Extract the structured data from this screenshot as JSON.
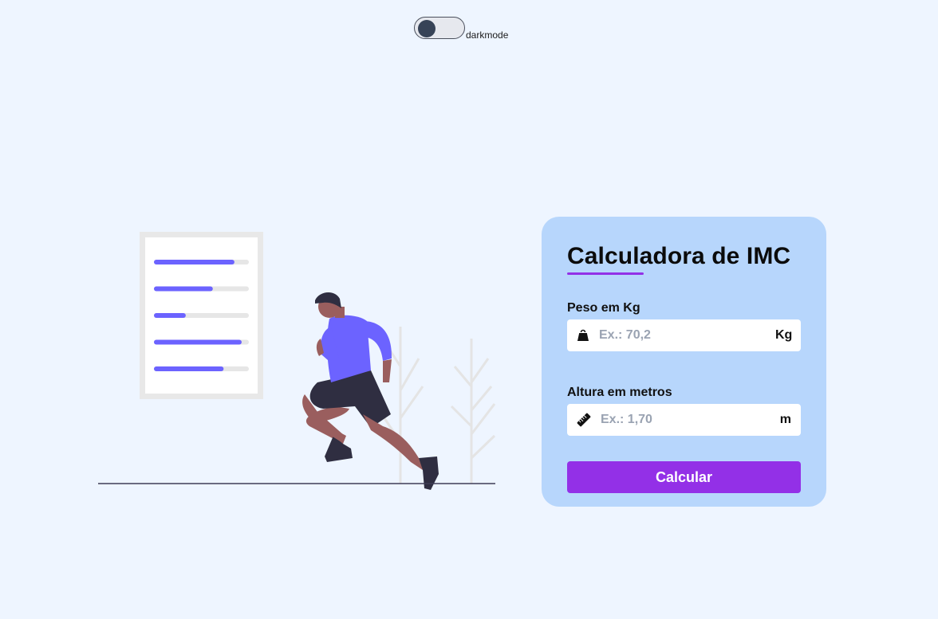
{
  "toggle": {
    "label": "darkmode"
  },
  "calculator": {
    "title": "Calculadora de IMC",
    "weight": {
      "label": "Peso em Kg",
      "placeholder": "Ex.: 70,2",
      "unit": "Kg",
      "icon": "weight-icon"
    },
    "height": {
      "label": "Altura em metros",
      "placeholder": "Ex.: 1,70",
      "unit": "m",
      "icon": "ruler-icon"
    },
    "button_label": "Calcular"
  },
  "colors": {
    "background": "#eef5ff",
    "card": "#b7d6fc",
    "accent": "#9330e7",
    "illustration_primary": "#6c63ff"
  },
  "illustration": {
    "subject": "person-running",
    "checklist_progress": [
      0.84,
      0.6,
      0.3,
      0.92,
      0.72
    ]
  }
}
